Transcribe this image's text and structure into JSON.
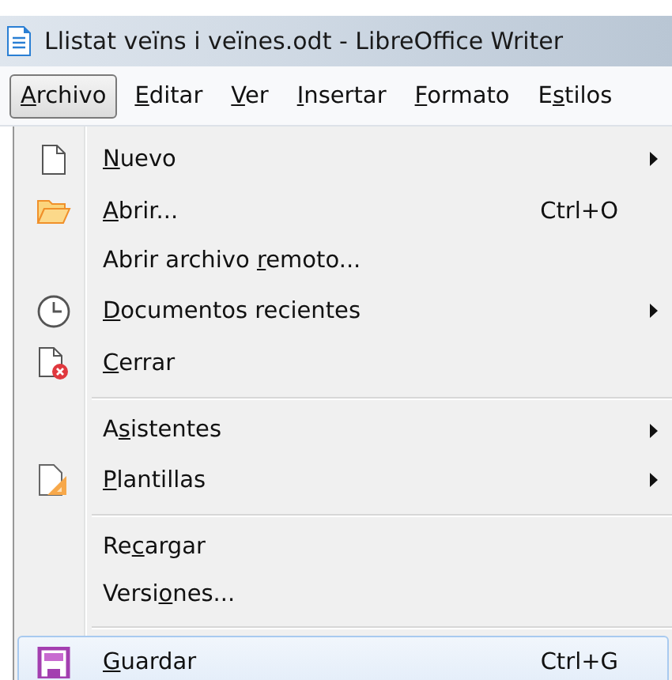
{
  "window": {
    "title": "Llistat veïns i veïnes.odt - LibreOffice Writer"
  },
  "menubar": [
    {
      "key": "A",
      "post": "rchivo",
      "selected": true
    },
    {
      "key": "E",
      "post": "ditar",
      "selected": false
    },
    {
      "key": "V",
      "post": "er",
      "selected": false
    },
    {
      "key": "I",
      "post": "nsertar",
      "selected": false
    },
    {
      "key": "F",
      "post": "ormato",
      "selected": false
    },
    {
      "pre": "E",
      "key": "s",
      "post": "tilos",
      "selected": false
    }
  ],
  "menu": [
    {
      "kind": "page",
      "key": "N",
      "post": "uevo",
      "submenu": true,
      "selected": false
    },
    {
      "kind": "folder",
      "key": "A",
      "post": "brir...",
      "shortcut": "Ctrl+O",
      "submenu": false,
      "selected": false
    },
    {
      "kind": "plain",
      "pre": "Abrir archivo ",
      "key": "r",
      "post": "emoto...",
      "submenu": false,
      "selected": false
    },
    {
      "kind": "clock",
      "key": "D",
      "post": "ocumentos recientes",
      "submenu": true,
      "selected": false
    },
    {
      "kind": "close",
      "key": "C",
      "post": "errar",
      "submenu": false,
      "selected": false
    },
    {
      "kind": "separator"
    },
    {
      "kind": "plain",
      "pre": "A",
      "key": "s",
      "post": "istentes",
      "submenu": true,
      "selected": false
    },
    {
      "kind": "template",
      "key": "P",
      "post": "lantillas",
      "submenu": true,
      "selected": false
    },
    {
      "kind": "separator"
    },
    {
      "kind": "plain",
      "pre": "Re",
      "key": "c",
      "post": "argar",
      "submenu": false,
      "selected": false
    },
    {
      "kind": "plain",
      "pre": "Versi",
      "key": "o",
      "post": "nes...",
      "submenu": false,
      "selected": false
    },
    {
      "kind": "separator"
    },
    {
      "kind": "disk",
      "key": "G",
      "post": "uardar",
      "shortcut": "Ctrl+G",
      "submenu": false,
      "selected": true
    }
  ]
}
